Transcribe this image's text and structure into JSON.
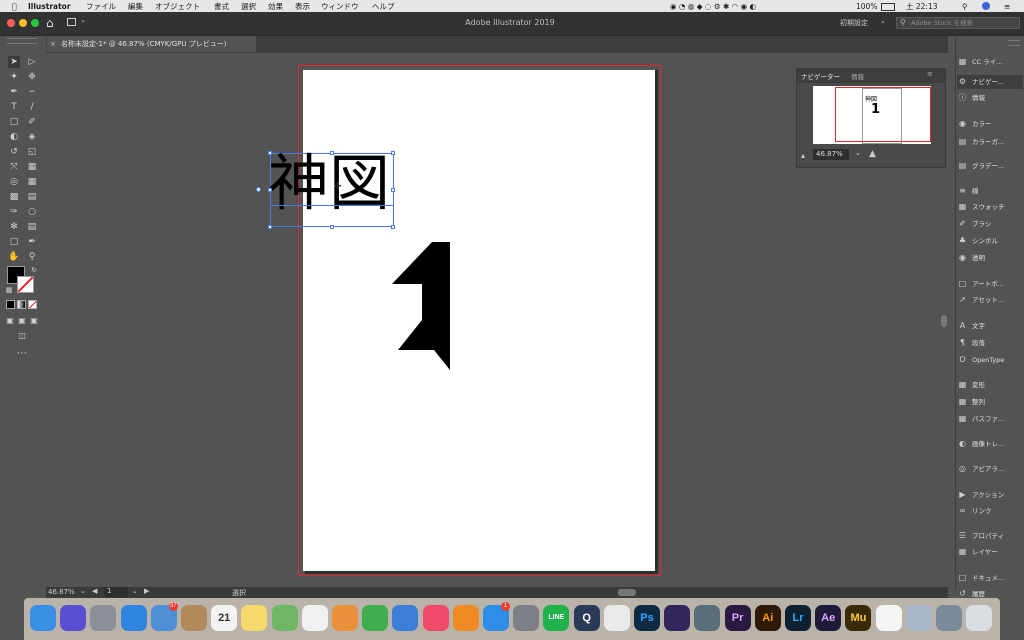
{
  "menubar": {
    "apple": "",
    "app_name": "Illustrator",
    "items": [
      "ファイル",
      "編集",
      "オブジェクト",
      "書式",
      "選択",
      "効果",
      "表示",
      "ウィンドウ",
      "ヘルプ"
    ],
    "battery": "100%",
    "clock": "土 22:13"
  },
  "titlebar": {
    "title": "Adobe Illustrator 2019",
    "workspace": "初期設定",
    "search_placeholder": "Adobe Stock を検索"
  },
  "document": {
    "tab_label": "名称未設定-1* @ 46.87% (CMYK/GPU プレビュー)",
    "close": "×"
  },
  "canvas": {
    "text_object": "神図"
  },
  "navigator": {
    "tabs": [
      "ナビゲーター",
      "情報"
    ],
    "zoom": "46.87%",
    "preview_text": "神図"
  },
  "statusbar": {
    "zoom": "46.87%",
    "page": "1",
    "mode": "選択"
  },
  "dock_panels": [
    {
      "icon": "cc-libraries-icon",
      "label": "CC ライ..."
    },
    {
      "icon": "navigator-icon",
      "label": "ナビゲー..."
    },
    {
      "icon": "info-icon",
      "label": "情報"
    },
    {
      "icon": "color-icon",
      "label": "カラー"
    },
    {
      "icon": "color-guide-icon",
      "label": "カラーガ..."
    },
    {
      "icon": "gradient-icon",
      "label": "グラデー..."
    },
    {
      "icon": "stroke-icon",
      "label": "線"
    },
    {
      "icon": "swatches-icon",
      "label": "スウォッチ"
    },
    {
      "icon": "brush-icon",
      "label": "ブラシ"
    },
    {
      "icon": "symbol-icon",
      "label": "シンボル"
    },
    {
      "icon": "transparency-icon",
      "label": "透明"
    },
    {
      "icon": "artboard-icon",
      "label": "アートボ..."
    },
    {
      "icon": "asset-icon",
      "label": "アセット..."
    },
    {
      "icon": "character-icon",
      "label": "文字"
    },
    {
      "icon": "paragraph-icon",
      "label": "段落"
    },
    {
      "icon": "opentype-icon",
      "label": "OpenType"
    },
    {
      "icon": "transform-icon",
      "label": "変形"
    },
    {
      "icon": "align-icon",
      "label": "整列"
    },
    {
      "icon": "pathfinder-icon",
      "label": "パスファ..."
    },
    {
      "icon": "image-trace-icon",
      "label": "画像トレ..."
    },
    {
      "icon": "appearance-icon",
      "label": "アピアラ..."
    },
    {
      "icon": "actions-icon",
      "label": "アクション"
    },
    {
      "icon": "links-icon",
      "label": "リンク"
    },
    {
      "icon": "properties-icon",
      "label": "プロパティ"
    },
    {
      "icon": "layers-icon",
      "label": "レイヤー"
    },
    {
      "icon": "document-info-icon",
      "label": "ドキュメ..."
    },
    {
      "icon": "history-icon",
      "label": "履歴"
    }
  ],
  "dock_apps": [
    {
      "name": "finder-icon",
      "label": "",
      "color": "#3a8ee6"
    },
    {
      "name": "siri-icon",
      "label": "",
      "color": "#5a4fd1"
    },
    {
      "name": "launchpad-icon",
      "label": "",
      "color": "#8a8f98"
    },
    {
      "name": "safari-icon",
      "label": "",
      "color": "#2f84e0"
    },
    {
      "name": "mail-icon",
      "label": "",
      "color": "#4e8fd6",
      "badge": "37"
    },
    {
      "name": "contacts-icon",
      "label": "",
      "color": "#b08a5a"
    },
    {
      "name": "calendar-icon",
      "label": "21",
      "color": "#f2f2f2"
    },
    {
      "name": "notes-icon",
      "label": "",
      "color": "#f5d96b"
    },
    {
      "name": "maps-icon",
      "label": "",
      "color": "#6fb765"
    },
    {
      "name": "photos-icon",
      "label": "",
      "color": "#f0f0f0"
    },
    {
      "name": "pages-icon",
      "label": "",
      "color": "#e8903a"
    },
    {
      "name": "numbers-icon",
      "label": "",
      "color": "#3fae4f"
    },
    {
      "name": "keynote-icon",
      "label": "",
      "color": "#3b7dd8"
    },
    {
      "name": "music-icon",
      "label": "",
      "color": "#f04a6a"
    },
    {
      "name": "books-icon",
      "label": "",
      "color": "#f08a24"
    },
    {
      "name": "appstore-icon",
      "label": "",
      "color": "#2e8de6",
      "badge": "1"
    },
    {
      "name": "preferences-icon",
      "label": "",
      "color": "#7d8086"
    },
    {
      "name": "line-icon",
      "label": "LINE",
      "color": "#20b24a"
    },
    {
      "name": "quicktime-icon",
      "label": "Q",
      "color": "#2a3b5a"
    },
    {
      "name": "chrome-icon",
      "label": "",
      "color": "#e9e9e9"
    },
    {
      "name": "photoshop-icon",
      "label": "Ps",
      "color": "#0e2a42"
    },
    {
      "name": "premiere-icon",
      "label": "",
      "color": "#33265a"
    },
    {
      "name": "gamepad-icon",
      "label": "",
      "color": "#5a6f7a"
    },
    {
      "name": "premiere-pro-icon",
      "label": "Pr",
      "color": "#2a1a40"
    },
    {
      "name": "illustrator-icon",
      "label": "Ai",
      "color": "#2e1a05"
    },
    {
      "name": "lightroom-icon",
      "label": "Lr",
      "color": "#0c2231"
    },
    {
      "name": "aftereffects-icon",
      "label": "Ae",
      "color": "#1f1a3a"
    },
    {
      "name": "muse-icon",
      "label": "Mu",
      "color": "#3a2a08"
    },
    {
      "name": "textedit-icon",
      "label": "",
      "color": "#f4f4f4"
    },
    {
      "name": "preview-icon",
      "label": "",
      "color": "#a6b5c9"
    },
    {
      "name": "imagecapture-icon",
      "label": "",
      "color": "#7a8a9a"
    },
    {
      "name": "trash-icon",
      "label": "",
      "color": "#d8dde2"
    }
  ]
}
